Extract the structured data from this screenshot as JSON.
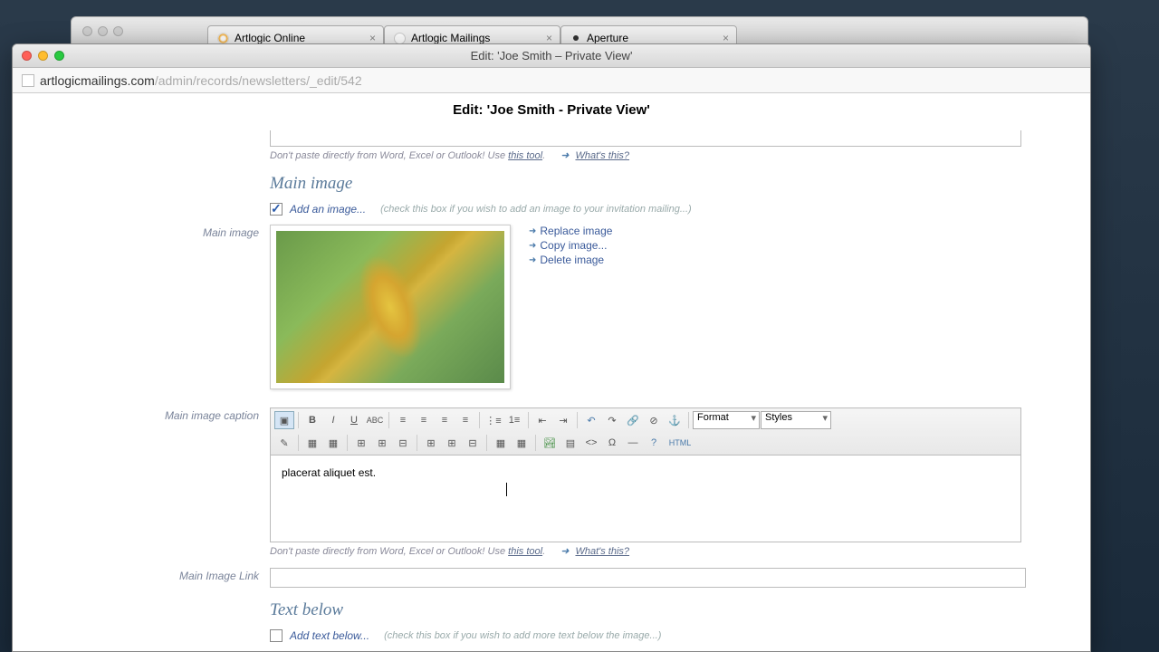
{
  "bg_tabs": [
    {
      "label": "Artlogic Online",
      "favicon": "radial-gradient(circle, #fff 30%, #f5a623 60%, transparent 70%)"
    },
    {
      "label": "Artlogic Mailings",
      "favicon": "#fff"
    },
    {
      "label": "Aperture",
      "favicon": "#333"
    }
  ],
  "modal": {
    "title": "Edit: 'Joe Smith – Private View'",
    "url_host": "artlogicmailings.com",
    "url_path": "/admin/records/newsletters/_edit/542",
    "page_heading": "Edit: 'Joe Smith - Private View'"
  },
  "hints": {
    "paste_warning_prefix": "Don't paste directly from Word, Excel or Outlook! Use ",
    "paste_tool": "this tool",
    "whats_this": "What's this?"
  },
  "sections": {
    "main_image": "Main image",
    "text_below": "Text below"
  },
  "add_image": {
    "checked": true,
    "label": "Add an image...",
    "hint": "(check this box if you wish to add an image to your invitation mailing...)"
  },
  "add_text": {
    "checked": false,
    "label": "Add text below...",
    "hint": "(check this box if you wish to add more text below the image...)"
  },
  "labels": {
    "main_image": "Main image",
    "main_image_caption": "Main image caption",
    "main_image_link": "Main Image Link"
  },
  "image_actions": {
    "replace": "Replace image",
    "copy": "Copy image...",
    "delete": "Delete image"
  },
  "rte": {
    "format": "Format",
    "styles": "Styles",
    "html": "HTML",
    "content": "placerat aliquet est."
  },
  "main_image_link_value": ""
}
